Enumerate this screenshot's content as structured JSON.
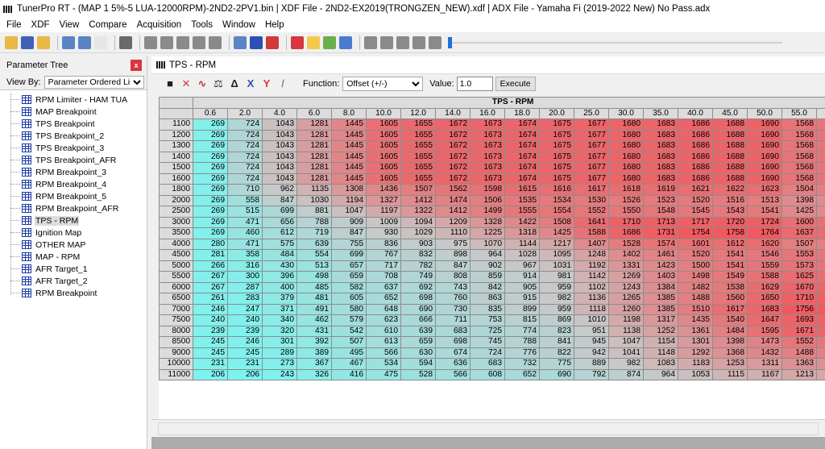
{
  "window": {
    "title": "TunerPro RT - (MAP 1 5%-5 LUA-12000RPM)-2ND2-2PV1.bin | XDF File - 2ND2-EX2019(TRONGZEN_NEW).xdf | ADX File - Yamaha Fi (2019-2022 New) No Pass.adx"
  },
  "menu": [
    "File",
    "XDF",
    "View",
    "Compare",
    "Acquisition",
    "Tools",
    "Window",
    "Help"
  ],
  "toolbar": {
    "icons": [
      {
        "name": "open-folder-icon",
        "color": "#e8b845"
      },
      {
        "name": "save-icon",
        "color": "#3f62b8"
      },
      {
        "name": "open-xdf-icon",
        "color": "#e8b845"
      },
      {
        "name": "sep"
      },
      {
        "name": "xdf-edit-icon",
        "color": "#5a84c4"
      },
      {
        "name": "xdf-copy-icon",
        "color": "#5a84c4"
      },
      {
        "name": "new-file-icon",
        "color": "#e6e6e6"
      },
      {
        "name": "sep"
      },
      {
        "name": "emulator-icon",
        "color": "#6a6a6a"
      },
      {
        "name": "sep"
      },
      {
        "name": "arrow-up-icon",
        "color": "#8a8a8a"
      },
      {
        "name": "arrow-down-icon",
        "color": "#8a8a8a"
      },
      {
        "name": "record-disabled-icon",
        "color": "#8a8a8a"
      },
      {
        "name": "stop-disabled-icon",
        "color": "#8a8a8a"
      },
      {
        "name": "chip-icon",
        "color": "#8a8a8a"
      },
      {
        "name": "sep"
      },
      {
        "name": "connect-icon",
        "color": "#5a84c4"
      },
      {
        "name": "swap-icon",
        "color": "#2f4fb6"
      },
      {
        "name": "compare-icon",
        "color": "#d23a3a"
      },
      {
        "name": "sep"
      },
      {
        "name": "acquire-icon",
        "color": "#d9363e"
      },
      {
        "name": "dashboard-icon",
        "color": "#f2c94c"
      },
      {
        "name": "gauge-icon",
        "color": "#6ab04c"
      },
      {
        "name": "bar-chart-icon",
        "color": "#4a7bd0"
      },
      {
        "name": "sep"
      },
      {
        "name": "record-icon",
        "color": "#8a8a8a"
      },
      {
        "name": "play-icon",
        "color": "#8a8a8a"
      },
      {
        "name": "pause-icon",
        "color": "#8a8a8a"
      },
      {
        "name": "stop-icon",
        "color": "#8a8a8a"
      },
      {
        "name": "eject-icon",
        "color": "#8a8a8a"
      }
    ],
    "playback_position": 0.0
  },
  "parameter_tree": {
    "title": "Parameter Tree",
    "close_glyph": "x",
    "view_by_label": "View By:",
    "view_by_value": "Parameter Ordered List",
    "items": [
      {
        "label": "RPM Limiter - HAM TUA",
        "selected": false
      },
      {
        "label": "MAP Breakpoint",
        "selected": false
      },
      {
        "label": "TPS Breakpoint",
        "selected": false
      },
      {
        "label": "TPS Breakpoint_2",
        "selected": false
      },
      {
        "label": "TPS Breakpoint_3",
        "selected": false
      },
      {
        "label": "TPS Breakpoint_AFR",
        "selected": false
      },
      {
        "label": "RPM Breakpoint_3",
        "selected": false
      },
      {
        "label": "RPM Breakpoint_4",
        "selected": false
      },
      {
        "label": "RPM Breakpoint_5",
        "selected": false
      },
      {
        "label": "RPM Breakpoint_AFR",
        "selected": false
      },
      {
        "label": "TPS - RPM",
        "selected": true
      },
      {
        "label": "Ignition Map",
        "selected": false
      },
      {
        "label": "OTHER MAP",
        "selected": false
      },
      {
        "label": "MAP - RPM",
        "selected": false
      },
      {
        "label": "AFR Target_1",
        "selected": false
      },
      {
        "label": "AFR Target_2",
        "selected": false
      },
      {
        "label": "RPM Breakpoint",
        "selected": false
      }
    ]
  },
  "table_window": {
    "title": "TPS - RPM",
    "tool_icons": [
      {
        "name": "save-table-icon",
        "glyph": "■",
        "color": "#1f1f1f"
      },
      {
        "name": "cancel-icon",
        "glyph": "✕",
        "color": "#d9363e"
      },
      {
        "name": "graph-icon",
        "glyph": "∿",
        "color": "#c03030"
      },
      {
        "name": "compare-scale-icon",
        "glyph": "⚖",
        "color": "#333333"
      },
      {
        "name": "delta-icon",
        "glyph": "Δ",
        "color": "#222222"
      },
      {
        "name": "x-axis-icon",
        "glyph": "X",
        "color": "#2f4fb6"
      },
      {
        "name": "y-axis-icon",
        "glyph": "Y",
        "color": "#d9363e"
      },
      {
        "name": "slash-icon",
        "glyph": "/",
        "color": "#888888"
      }
    ],
    "function_label": "Function:",
    "function_value": "Offset (+/-)",
    "value_label": "Value:",
    "value_input": "1.0",
    "execute_label": "Execute",
    "axis_title": "TPS - RPM",
    "columns": [
      "0.6",
      "2.0",
      "4.0",
      "6.0",
      "8.0",
      "10.0",
      "12.0",
      "14.0",
      "16.0",
      "18.0",
      "20.0",
      "25.0",
      "30.0",
      "35.0",
      "40.0",
      "45.0",
      "50.0",
      "55.0"
    ],
    "rows": [
      {
        "rpm": "1100",
        "values": [
          269,
          724,
          1043,
          1281,
          1445,
          1605,
          1655,
          1672,
          1673,
          1674,
          1675,
          1677,
          1680,
          1683,
          1686,
          1688,
          1690,
          1568
        ]
      },
      {
        "rpm": "1200",
        "values": [
          269,
          724,
          1043,
          1281,
          1445,
          1605,
          1655,
          1672,
          1673,
          1674,
          1675,
          1677,
          1680,
          1683,
          1686,
          1688,
          1690,
          1568
        ]
      },
      {
        "rpm": "1300",
        "values": [
          269,
          724,
          1043,
          1281,
          1445,
          1605,
          1655,
          1672,
          1673,
          1674,
          1675,
          1677,
          1680,
          1683,
          1686,
          1688,
          1690,
          1568
        ]
      },
      {
        "rpm": "1400",
        "values": [
          269,
          724,
          1043,
          1281,
          1445,
          1605,
          1655,
          1672,
          1673,
          1674,
          1675,
          1677,
          1680,
          1683,
          1686,
          1688,
          1690,
          1568
        ]
      },
      {
        "rpm": "1500",
        "values": [
          269,
          724,
          1043,
          1281,
          1445,
          1605,
          1655,
          1672,
          1673,
          1674,
          1675,
          1677,
          1680,
          1683,
          1686,
          1688,
          1690,
          1568
        ]
      },
      {
        "rpm": "1600",
        "values": [
          269,
          724,
          1043,
          1281,
          1445,
          1605,
          1655,
          1672,
          1673,
          1674,
          1675,
          1677,
          1680,
          1683,
          1686,
          1688,
          1690,
          1568
        ]
      },
      {
        "rpm": "1800",
        "values": [
          269,
          710,
          962,
          1135,
          1308,
          1436,
          1507,
          1562,
          1598,
          1615,
          1616,
          1617,
          1618,
          1619,
          1621,
          1622,
          1623,
          1504
        ]
      },
      {
        "rpm": "2000",
        "values": [
          269,
          558,
          847,
          1030,
          1194,
          1327,
          1412,
          1474,
          1506,
          1535,
          1534,
          1530,
          1526,
          1523,
          1520,
          1516,
          1513,
          1398
        ]
      },
      {
        "rpm": "2500",
        "values": [
          269,
          515,
          699,
          881,
          1047,
          1197,
          1322,
          1412,
          1499,
          1555,
          1554,
          1552,
          1550,
          1548,
          1545,
          1543,
          1541,
          1425
        ]
      },
      {
        "rpm": "3000",
        "values": [
          269,
          471,
          656,
          788,
          909,
          1009,
          1094,
          1209,
          1328,
          1422,
          1508,
          1641,
          1710,
          1713,
          1717,
          1720,
          1724,
          1600
        ]
      },
      {
        "rpm": "3500",
        "values": [
          269,
          460,
          612,
          719,
          847,
          930,
          1029,
          1110,
          1225,
          1318,
          1425,
          1588,
          1686,
          1731,
          1754,
          1758,
          1764,
          1637
        ]
      },
      {
        "rpm": "4000",
        "values": [
          280,
          471,
          575,
          639,
          755,
          836,
          903,
          975,
          1070,
          1144,
          1217,
          1407,
          1528,
          1574,
          1601,
          1612,
          1620,
          1507
        ]
      },
      {
        "rpm": "4500",
        "values": [
          281,
          358,
          484,
          554,
          699,
          767,
          832,
          898,
          964,
          1028,
          1095,
          1248,
          1402,
          1461,
          1520,
          1541,
          1546,
          1553
        ]
      },
      {
        "rpm": "5000",
        "values": [
          266,
          316,
          430,
          513,
          657,
          717,
          782,
          847,
          902,
          967,
          1031,
          1192,
          1331,
          1423,
          1500,
          1541,
          1559,
          1573
        ]
      },
      {
        "rpm": "5500",
        "values": [
          267,
          300,
          396,
          498,
          659,
          708,
          749,
          808,
          859,
          914,
          981,
          1142,
          1269,
          1403,
          1498,
          1549,
          1588,
          1625
        ]
      },
      {
        "rpm": "6000",
        "values": [
          267,
          287,
          400,
          485,
          582,
          637,
          692,
          743,
          842,
          905,
          959,
          1102,
          1243,
          1384,
          1482,
          1538,
          1629,
          1670
        ]
      },
      {
        "rpm": "6500",
        "values": [
          261,
          283,
          379,
          481,
          605,
          652,
          698,
          760,
          863,
          915,
          982,
          1136,
          1265,
          1385,
          1488,
          1560,
          1650,
          1710
        ]
      },
      {
        "rpm": "7000",
        "values": [
          246,
          247,
          371,
          491,
          580,
          648,
          690,
          730,
          835,
          899,
          959,
          1118,
          1260,
          1385,
          1510,
          1617,
          1683,
          1756
        ]
      },
      {
        "rpm": "7500",
        "values": [
          240,
          240,
          340,
          462,
          579,
          623,
          666,
          711,
          753,
          815,
          869,
          1010,
          1198,
          1317,
          1435,
          1540,
          1647,
          1693
        ]
      },
      {
        "rpm": "8000",
        "values": [
          239,
          239,
          320,
          431,
          542,
          610,
          639,
          683,
          725,
          774,
          823,
          951,
          1138,
          1252,
          1361,
          1484,
          1595,
          1671
        ]
      },
      {
        "rpm": "8500",
        "values": [
          245,
          246,
          301,
          392,
          507,
          613,
          659,
          698,
          745,
          788,
          841,
          945,
          1047,
          1154,
          1301,
          1398,
          1473,
          1552
        ]
      },
      {
        "rpm": "9000",
        "values": [
          245,
          245,
          289,
          389,
          495,
          566,
          630,
          674,
          724,
          776,
          822,
          942,
          1041,
          1148,
          1292,
          1368,
          1432,
          1488
        ]
      },
      {
        "rpm": "10000",
        "values": [
          231,
          231,
          273,
          367,
          467,
          534,
          594,
          636,
          683,
          732,
          775,
          889,
          982,
          1083,
          1183,
          1253,
          1311,
          1363
        ]
      },
      {
        "rpm": "11000",
        "values": [
          206,
          206,
          243,
          326,
          416,
          475,
          528,
          566,
          608,
          652,
          690,
          792,
          874,
          964,
          1053,
          1115,
          1167,
          1213
        ]
      }
    ],
    "color_low": "#7df3ef",
    "color_mid": "#c8c8c8",
    "color_high": "#f0595e"
  }
}
